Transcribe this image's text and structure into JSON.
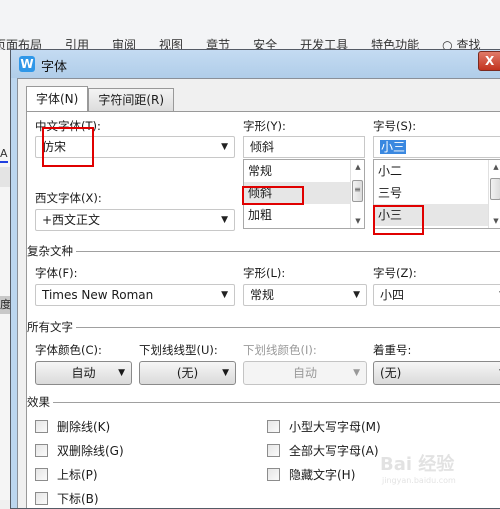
{
  "ribbon": {
    "tabs": [
      "页面布局",
      "引用",
      "审阅",
      "视图",
      "章节",
      "安全",
      "开发工具",
      "特色功能",
      "查找"
    ]
  },
  "left_strip": {
    "a_label": "A",
    "du_label": "度"
  },
  "dialog": {
    "title": "字体",
    "app_icon": "W",
    "close_label": "X",
    "tabs": [
      {
        "label": "字体(N)",
        "active": true
      },
      {
        "label": "字符间距(R)",
        "active": false
      }
    ],
    "chinese_font": {
      "label": "中文字体(T):",
      "value": "仿宋"
    },
    "western_font": {
      "label": "西文字体(X):",
      "value": "+西文正文"
    },
    "style": {
      "label": "字形(Y):",
      "value": "倾斜",
      "options": [
        "常规",
        "倾斜",
        "加粗"
      ],
      "selected_index": 1
    },
    "size": {
      "label": "字号(S):",
      "value": "小三",
      "options": [
        "小二",
        "三号",
        "小三"
      ],
      "selected_index": 2
    },
    "complex": {
      "group_title": "复杂文种",
      "font_label": "字体(F):",
      "font_value": "Times New Roman",
      "style_label": "字形(L):",
      "style_value": "常规",
      "size_label": "字号(Z):",
      "size_value": "小四"
    },
    "all_text": {
      "group_title": "所有文字",
      "color_label": "字体颜色(C):",
      "color_value": "自动",
      "underline_label": "下划线线型(U):",
      "underline_value": "(无)",
      "underline_color_label": "下划线颜色(I):",
      "underline_color_value": "自动",
      "emphasis_label": "着重号:",
      "emphasis_value": "(无)"
    },
    "effects": {
      "group_title": "效果",
      "left": [
        {
          "label": "删除线(K)",
          "checked": false
        },
        {
          "label": "双删除线(G)",
          "checked": false
        },
        {
          "label": "上标(P)",
          "checked": false
        },
        {
          "label": "下标(B)",
          "checked": false
        }
      ],
      "right": [
        {
          "label": "小型大写字母(M)",
          "checked": false
        },
        {
          "label": "全部大写字母(A)",
          "checked": false
        },
        {
          "label": "隐藏文字(H)",
          "checked": false
        }
      ]
    }
  },
  "watermark": {
    "main": "Bai 经验",
    "sub": "jingyan.baidu.com"
  },
  "colors": {
    "highlight_box": "#e00000",
    "selection": "#3a88e0",
    "titlebar": "#bcd6ef"
  }
}
